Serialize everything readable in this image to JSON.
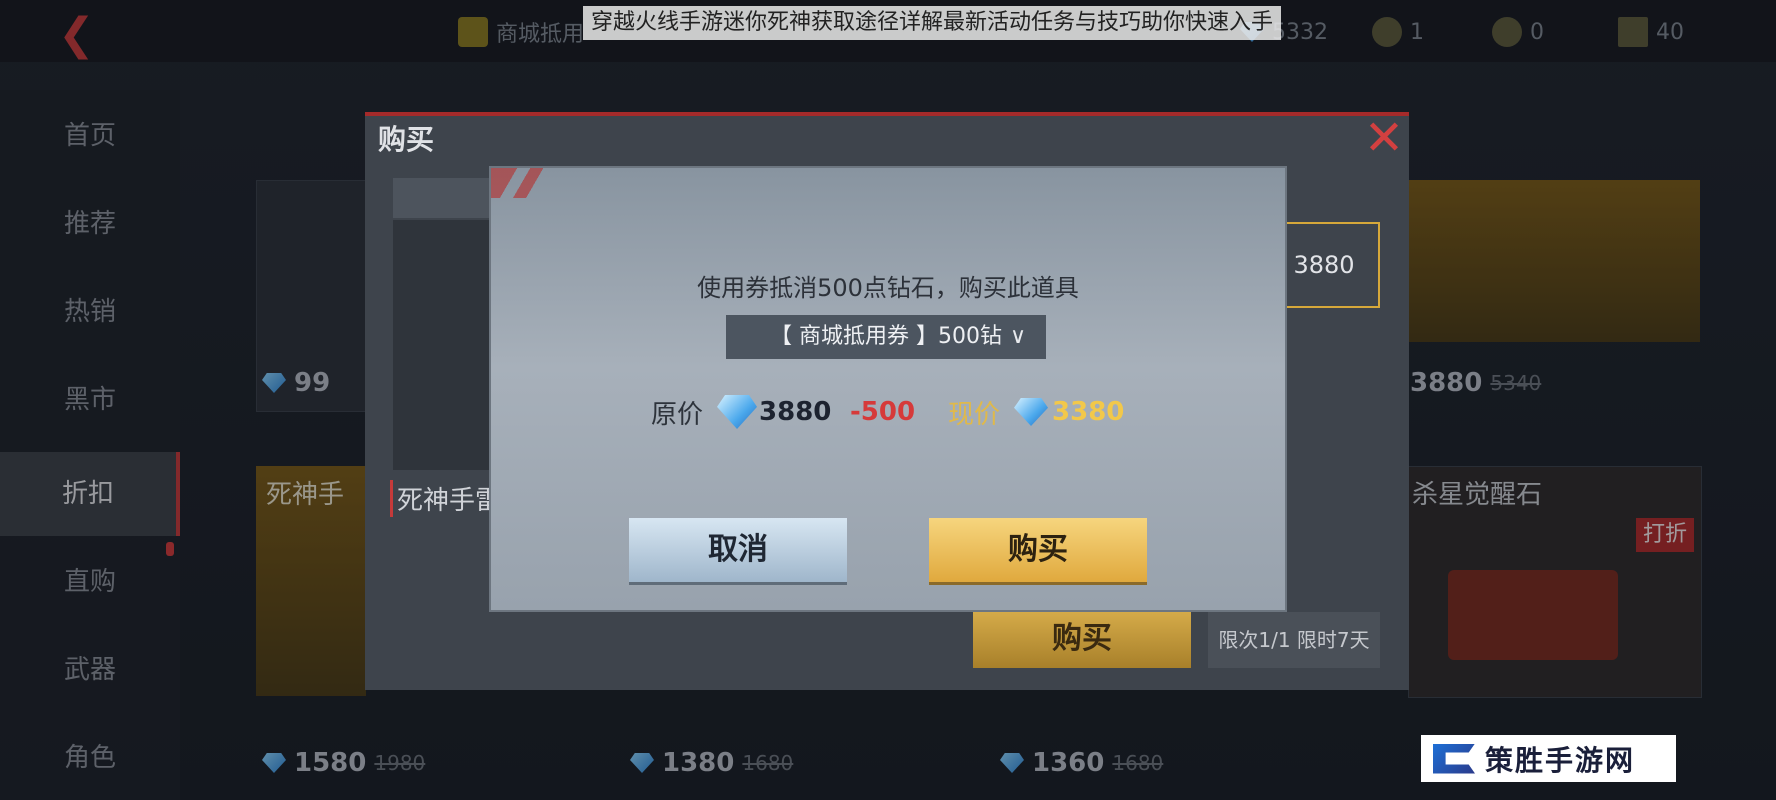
{
  "headline": "穿越火线手游迷你死神获取途径详解最新活动任务与技巧助你快速入手",
  "topbar": {
    "resources": [
      {
        "icon": "coupon-icon",
        "value": "商城抵用"
      },
      {
        "icon": "diamond-icon",
        "value": "5332"
      },
      {
        "icon": "medal-icon",
        "value": "1"
      },
      {
        "icon": "badge-icon",
        "value": "0"
      },
      {
        "icon": "flag-icon",
        "value": "40"
      }
    ]
  },
  "sidebar": {
    "items": [
      {
        "label": "首页"
      },
      {
        "label": "推荐"
      },
      {
        "label": "热销"
      },
      {
        "label": "黑市"
      },
      {
        "label": "折扣"
      },
      {
        "label": "直购"
      },
      {
        "label": "武器"
      },
      {
        "label": "角色"
      }
    ],
    "active_index": 4
  },
  "store": {
    "top_left_price": "99",
    "top_right_price": "3880",
    "top_right_old_price": "5340",
    "left_item_name": "死神手",
    "right_item_name": "杀星觉醒石",
    "right_tag": "打折",
    "bottom_prices": [
      {
        "price": "1580",
        "old": "1980"
      },
      {
        "price": "1380",
        "old": "1680"
      },
      {
        "price": "1360",
        "old": "1680"
      }
    ]
  },
  "outer_dialog": {
    "title": "购买",
    "item_name": "死神手雷",
    "price_box": "3880",
    "buy_label": "购买",
    "limit_text": "限次1/1 限时7天"
  },
  "confirm_dialog": {
    "message": "使用券抵消500点钻石，购买此道具",
    "coupon_select": "【 商城抵用券 】500钻",
    "original_label": "原价",
    "original_price": "3880",
    "discount": "-500",
    "current_label": "现价",
    "current_price": "3380",
    "cancel_label": "取消",
    "buy_label": "购买"
  },
  "watermark": {
    "text": "策胜手游网"
  },
  "colors": {
    "accent_red": "#c53a3a",
    "gold": "#e0a93e",
    "discount_red": "#d63a3a",
    "current_price_gold": "#f2c84a"
  }
}
